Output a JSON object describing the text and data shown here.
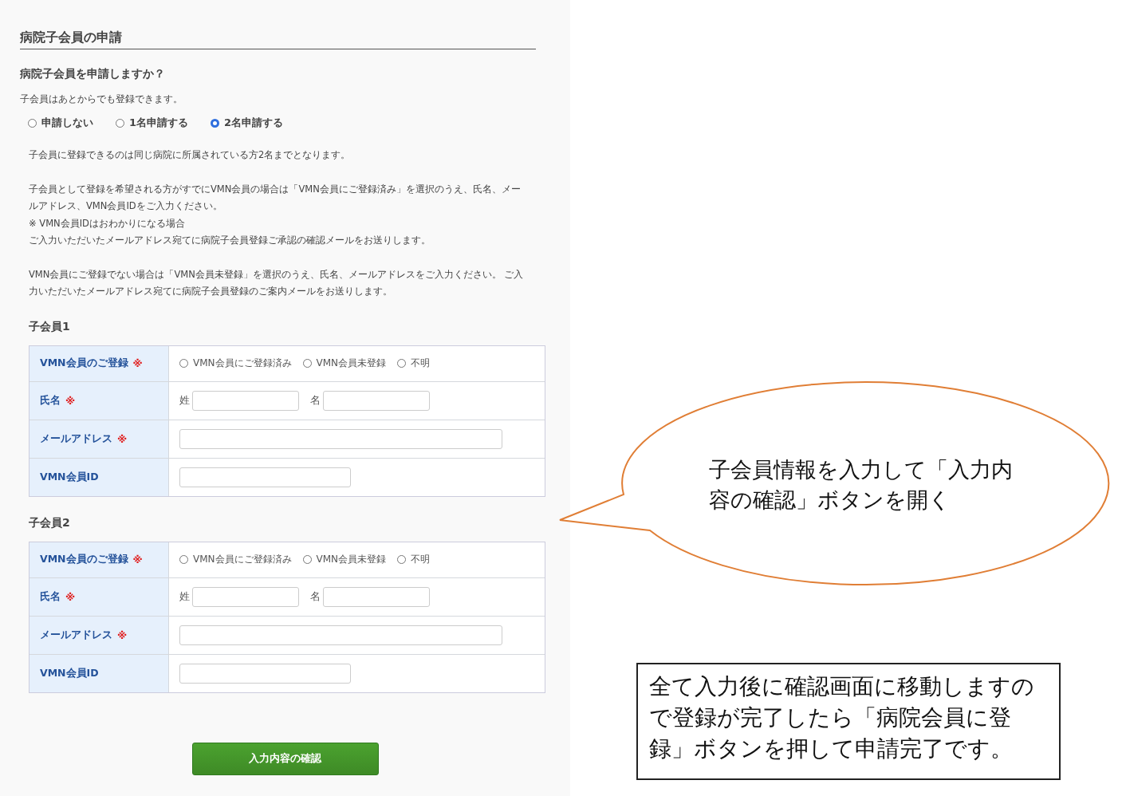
{
  "section_title": "病院子会員の申請",
  "question": "病院子会員を申請しますか？",
  "hint": "子会員はあとからでも登録できます。",
  "count_options": [
    {
      "label": "申請しない",
      "selected": false
    },
    {
      "label": "1名申請する",
      "selected": false
    },
    {
      "label": "2名申請する",
      "selected": true
    }
  ],
  "notes": [
    [
      "子会員に登録できるのは同じ病院に所属されている方2名までとなります。"
    ],
    [
      "子会員として登録を希望される方がすでにVMN会員の場合は「VMN会員にご登録済み」を選択のうえ、氏名、メールアドレス、VMN会員IDをご入力ください。",
      "※ VMN会員IDはおわかりになる場合",
      "ご入力いただいたメールアドレス宛てに病院子会員登録ご承認の確認メールをお送りします。"
    ],
    [
      "VMN会員にご登録でない場合は「VMN会員未登録」を選択のうえ、氏名、メールアドレスをご入力ください。 ご入力いただいたメールアドレス宛てに病院子会員登録のご案内メールをお送りします。"
    ]
  ],
  "members": [
    {
      "title": "子会員1",
      "rows": [
        {
          "kind": "radio",
          "label": "VMN会員のご登録",
          "mark": "※",
          "options": [
            {
              "label": "VMN会員にご登録済み",
              "selected": false
            },
            {
              "label": "VMN会員未登録",
              "selected": false
            },
            {
              "label": "不明",
              "selected": false
            }
          ]
        },
        {
          "kind": "name",
          "label": "氏名",
          "mark": "※",
          "fields": [
            {
              "label": "姓"
            },
            {
              "label": "名"
            }
          ]
        },
        {
          "kind": "email",
          "label": "メールアドレス",
          "mark": "※"
        },
        {
          "kind": "id",
          "label": "VMN会員ID"
        }
      ]
    },
    {
      "title": "子会員2",
      "rows": [
        {
          "kind": "radio",
          "label": "VMN会員のご登録",
          "mark": "※",
          "options": [
            {
              "label": "VMN会員にご登録済み",
              "selected": false
            },
            {
              "label": "VMN会員未登録",
              "selected": false
            },
            {
              "label": "不明",
              "selected": false
            }
          ]
        },
        {
          "kind": "name",
          "label": "氏名",
          "mark": "※",
          "fields": [
            {
              "label": "姓"
            },
            {
              "label": "名"
            }
          ]
        },
        {
          "kind": "email",
          "label": "メールアドレス",
          "mark": "※"
        },
        {
          "kind": "id",
          "label": "VMN会員ID"
        }
      ]
    }
  ],
  "submit_button": "入力内容の確認",
  "callout": {
    "text": "子会員情報を入力して「入力内容の確認」ボタンを開く"
  },
  "note": {
    "text": "全て入力後に確認画面に移動しますので登録が完了したら「病院会員に登録」ボタンを押して申請完了です。"
  }
}
